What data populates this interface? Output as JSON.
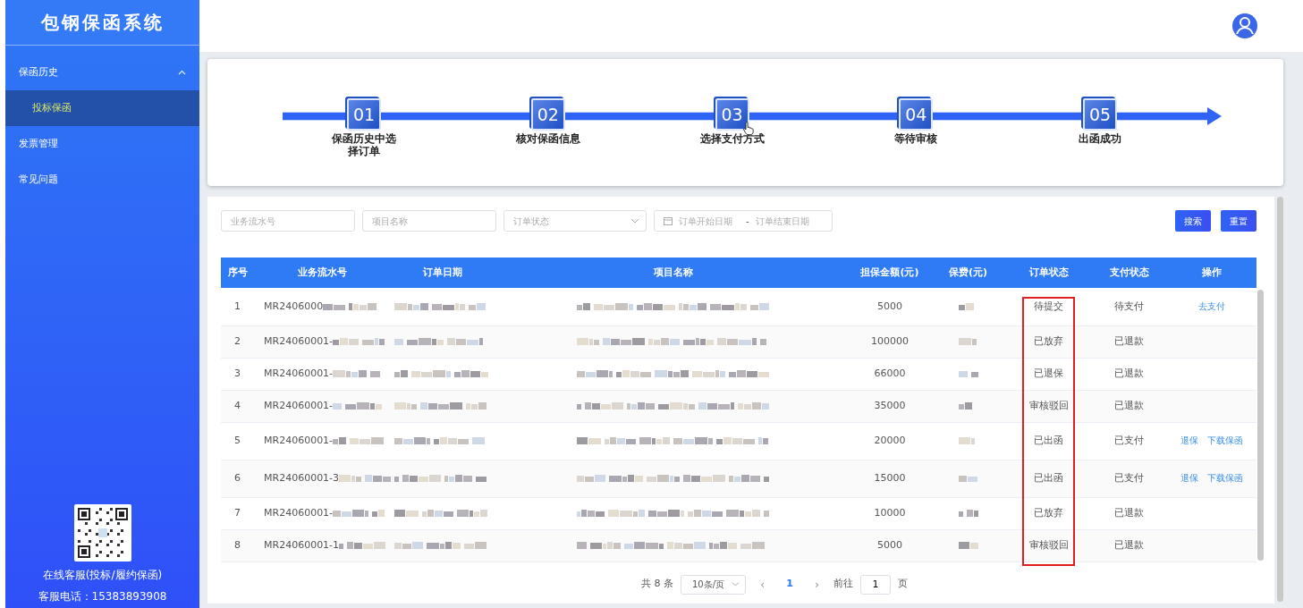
{
  "app": {
    "title": "包钢保函系统"
  },
  "sidebar": {
    "items": [
      {
        "label": "保函历史",
        "expanded": true,
        "children": [
          {
            "label": "投标保函",
            "selected": true
          }
        ]
      },
      {
        "label": "发票管理"
      },
      {
        "label": "常见问题"
      }
    ],
    "service_label": "在线客服(投标/履约保函)",
    "phone": "客服电话：15383893908"
  },
  "steps": [
    {
      "number": "01",
      "label": "保函历史中选择订单"
    },
    {
      "number": "02",
      "label": "核对保函信息"
    },
    {
      "number": "03",
      "label": "选择支付方式"
    },
    {
      "number": "04",
      "label": "等待审核"
    },
    {
      "number": "05",
      "label": "出函成功"
    }
  ],
  "filters": {
    "serial_placeholder": "业务流水号",
    "project_placeholder": "项目名称",
    "status_placeholder": "订单状态",
    "start_placeholder": "订单开始日期",
    "range_separator": "-",
    "end_placeholder": "订单结束日期",
    "buttons": [
      "搜索",
      "重置"
    ]
  },
  "table": {
    "columns": [
      "序号",
      "业务流水号",
      "订单日期",
      "项目名称",
      "担保金额(元)",
      "保费(元)",
      "订单状态",
      "支付状态",
      "操作"
    ],
    "status_highlight": true,
    "rows": [
      {
        "index": "1",
        "serial": "MR2406000",
        "amount": "5000",
        "order_status": "待提交",
        "pay_status": "待支付",
        "actions": [
          "去支付"
        ]
      },
      {
        "index": "2",
        "serial": "MR24060001-",
        "amount": "100000",
        "order_status": "已放弃",
        "pay_status": "已退款",
        "actions": []
      },
      {
        "index": "3",
        "serial": "MR24060001-",
        "amount": "66000",
        "order_status": "已退保",
        "pay_status": "已退款",
        "actions": []
      },
      {
        "index": "4",
        "serial": "MR24060001-",
        "amount": "35000",
        "order_status": "审核驳回",
        "pay_status": "已退款",
        "actions": []
      },
      {
        "index": "5",
        "serial": "MR24060001-",
        "amount": "20000",
        "order_status": "已出函",
        "pay_status": "已支付",
        "actions": [
          "退保",
          "下载保函"
        ]
      },
      {
        "index": "6",
        "serial": "MR24060001-3",
        "amount": "15000",
        "order_status": "已出函",
        "pay_status": "已支付",
        "actions": [
          "退保",
          "下载保函"
        ]
      },
      {
        "index": "7",
        "serial": "MR24060001-",
        "amount": "10000",
        "order_status": "已放弃",
        "pay_status": "已退款",
        "actions": []
      },
      {
        "index": "8",
        "serial": "MR24060001-1",
        "amount": "5000",
        "order_status": "审核驳回",
        "pay_status": "已退款",
        "actions": []
      }
    ]
  },
  "pagination": {
    "total": "共 8 条",
    "page_size": "10条/页",
    "prev": "‹",
    "pages": [
      {
        "label": "1",
        "selected": true
      }
    ],
    "next": "›",
    "goto_label": "前往",
    "goto_value": "1",
    "goto_suffix": "页"
  }
}
